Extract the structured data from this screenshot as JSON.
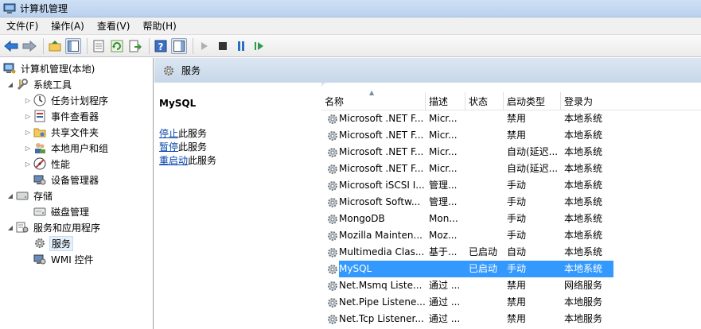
{
  "window": {
    "title": "计算机管理"
  },
  "menu": [
    "文件(F)",
    "操作(A)",
    "查看(V)",
    "帮助(H)"
  ],
  "toolbar": {
    "buttons": [
      "back-icon",
      "forward-icon",
      "up-folder-icon",
      "show-tree-icon",
      "properties-icon",
      "refresh-icon",
      "export-icon",
      "help-icon",
      "show-action-pane-icon",
      "play-icon",
      "stop-icon",
      "pause-icon",
      "restart-icon"
    ]
  },
  "tree": {
    "root": "计算机管理(本地)",
    "system_tools": "系统工具",
    "task_scheduler": "任务计划程序",
    "event_viewer": "事件查看器",
    "shared_folders": "共享文件夹",
    "local_users": "本地用户和组",
    "performance": "性能",
    "device_manager": "设备管理器",
    "storage": "存储",
    "disk_management": "磁盘管理",
    "services_apps": "服务和应用程序",
    "services": "服务",
    "wmi": "WMI 控件"
  },
  "header": {
    "title": "服务"
  },
  "detail": {
    "service_name": "MySQL",
    "stop_link": "停止",
    "stop_suffix": "此服务",
    "pause_link": "暂停",
    "pause_suffix": "此服务",
    "restart_link": "重启动",
    "restart_suffix": "此服务"
  },
  "columns": [
    "名称",
    "描述",
    "状态",
    "启动类型",
    "登录为"
  ],
  "rows": [
    {
      "name": "Microsoft .NET F...",
      "desc": "Micr...",
      "status": "",
      "startup": "禁用",
      "logon": "本地系统"
    },
    {
      "name": "Microsoft .NET F...",
      "desc": "Micr...",
      "status": "",
      "startup": "禁用",
      "logon": "本地系统"
    },
    {
      "name": "Microsoft .NET F...",
      "desc": "Micr...",
      "status": "",
      "startup": "自动(延迟...",
      "logon": "本地系统"
    },
    {
      "name": "Microsoft .NET F...",
      "desc": "Micr...",
      "status": "",
      "startup": "自动(延迟...",
      "logon": "本地系统"
    },
    {
      "name": "Microsoft iSCSI I...",
      "desc": "管理...",
      "status": "",
      "startup": "手动",
      "logon": "本地系统"
    },
    {
      "name": "Microsoft Softw...",
      "desc": "管理...",
      "status": "",
      "startup": "手动",
      "logon": "本地系统"
    },
    {
      "name": "MongoDB",
      "desc": "Mon...",
      "status": "",
      "startup": "手动",
      "logon": "本地系统"
    },
    {
      "name": "Mozilla Mainten...",
      "desc": "Moz...",
      "status": "",
      "startup": "手动",
      "logon": "本地系统"
    },
    {
      "name": "Multimedia Clas...",
      "desc": "基于...",
      "status": "已启动",
      "startup": "自动",
      "logon": "本地系统"
    },
    {
      "name": "MySQL",
      "desc": "",
      "status": "已启动",
      "startup": "手动",
      "logon": "本地系统"
    },
    {
      "name": "Net.Msmq Liste...",
      "desc": "通过 ...",
      "status": "",
      "startup": "禁用",
      "logon": "网络服务"
    },
    {
      "name": "Net.Pipe Listene...",
      "desc": "通过 ...",
      "status": "",
      "startup": "禁用",
      "logon": "本地服务"
    },
    {
      "name": "Net.Tcp Listener...",
      "desc": "通过 ...",
      "status": "",
      "startup": "禁用",
      "logon": "本地服务"
    }
  ],
  "selected_row": 9
}
